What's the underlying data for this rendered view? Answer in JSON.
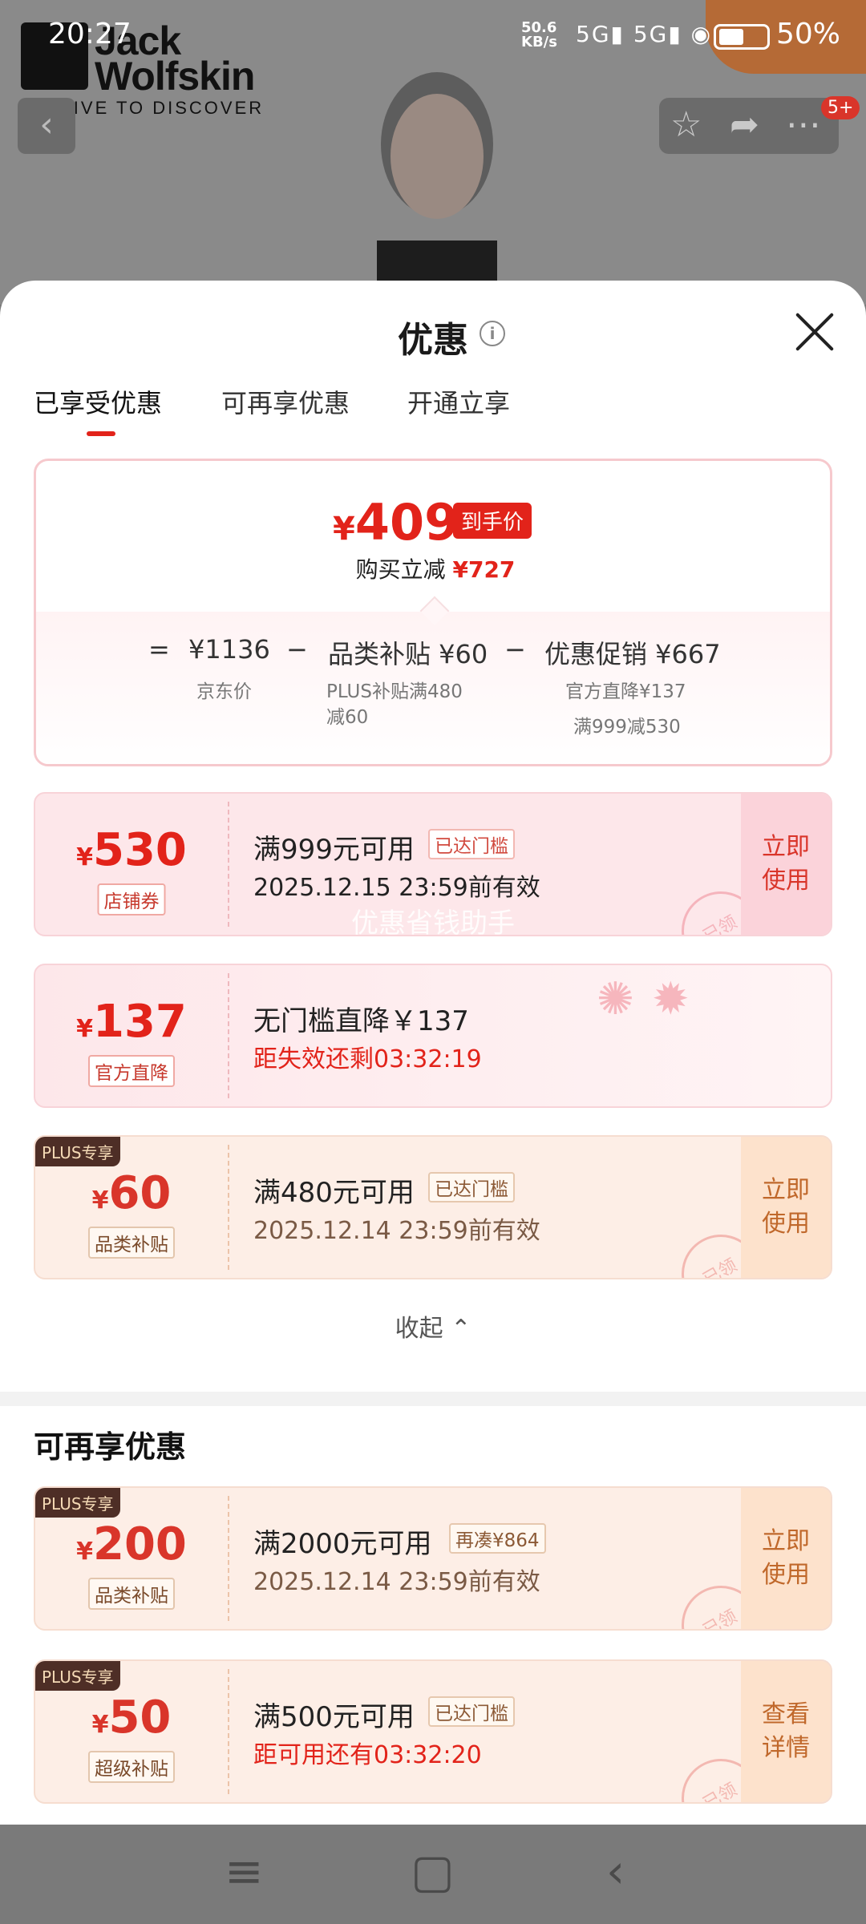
{
  "status_bar": {
    "time": "20:27",
    "net_speed_top": "50.6",
    "net_speed_bottom": "KB/s",
    "signal": "5G▮ 5G▮ ◉",
    "battery": "50%"
  },
  "brand": {
    "line1": "Jack",
    "line2": "Wolfskin",
    "tagline": "WE LIVE TO DISCOVER"
  },
  "header": {
    "badge": "5+"
  },
  "sheet": {
    "title": "优惠",
    "tabs": [
      "已享受优惠",
      "可再享优惠",
      "开通立享"
    ],
    "active_tab": 0
  },
  "summary": {
    "currency": "¥",
    "final_price": "409",
    "final_price_tag": "到手价",
    "reduce_label": "购买立减",
    "reduce_amount": "¥727",
    "formula": {
      "eq": "=",
      "jd_price": "¥1136",
      "minus1": "−",
      "category": "品类补贴 ¥60",
      "minus2": "−",
      "promo": "优惠促销 ¥667"
    },
    "labels": {
      "jd_price": "京东价",
      "category": "PLUS补贴满480\n减60",
      "promo_line1": "官方直降¥137",
      "promo_line2": "满999减530"
    }
  },
  "enjoyed_coupons": [
    {
      "style": "pink",
      "currency": "¥",
      "amount": "530",
      "type": "店铺券",
      "plus": "",
      "title": "满999元可用",
      "reach": "已达门槛",
      "sub": "2025.12.15 23:59前有效",
      "action": "立即\n使用",
      "stamp": "已领"
    },
    {
      "style": "pink",
      "currency": "¥",
      "amount": "137",
      "type": "官方直降",
      "plus": "",
      "title": "无门槛直降￥137",
      "reach": "",
      "sub": "距失效还剩03:32:19",
      "action": "",
      "stamp": ""
    },
    {
      "style": "orange",
      "currency": "¥",
      "amount": "60",
      "type": "品类补贴",
      "plus": "PLUS专享",
      "title": "满480元可用",
      "reach": "已达门槛",
      "sub": "2025.12.14 23:59前有效",
      "action": "立即\n使用",
      "stamp": "已领"
    }
  ],
  "watermark": "优惠省钱助手",
  "collapse_label": "收起 ⌃",
  "more_section_title": "可再享优惠",
  "more_coupons": [
    {
      "style": "orange",
      "currency": "¥",
      "amount": "200",
      "type": "品类补贴",
      "plus": "PLUS专享",
      "title": "满2000元可用",
      "reach": "再凑¥864",
      "sub": "2025.12.14 23:59前有效",
      "action": "立即\n使用",
      "stamp": "已领"
    },
    {
      "style": "orange",
      "currency": "¥",
      "amount": "50",
      "type": "超级补贴",
      "plus": "PLUS专享",
      "title": "满500元可用",
      "reach": "已达门槛",
      "sub": "距可用还有03:32:20",
      "action": "查看\n详情",
      "stamp": "已领"
    }
  ],
  "colors": {
    "accent": "#e2231a",
    "plus_bg": "#4e2e26"
  }
}
